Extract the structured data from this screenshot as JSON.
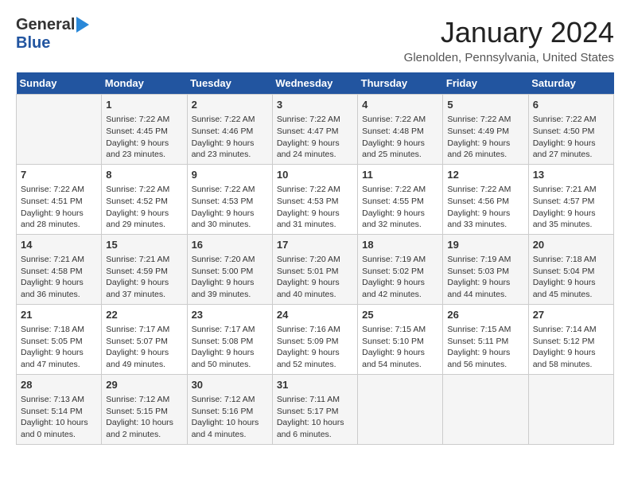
{
  "logo": {
    "general": "General",
    "blue": "Blue"
  },
  "title": "January 2024",
  "location": "Glenolden, Pennsylvania, United States",
  "days_header": [
    "Sunday",
    "Monday",
    "Tuesday",
    "Wednesday",
    "Thursday",
    "Friday",
    "Saturday"
  ],
  "weeks": [
    [
      {
        "day": "",
        "info": ""
      },
      {
        "day": "1",
        "info": "Sunrise: 7:22 AM\nSunset: 4:45 PM\nDaylight: 9 hours\nand 23 minutes."
      },
      {
        "day": "2",
        "info": "Sunrise: 7:22 AM\nSunset: 4:46 PM\nDaylight: 9 hours\nand 23 minutes."
      },
      {
        "day": "3",
        "info": "Sunrise: 7:22 AM\nSunset: 4:47 PM\nDaylight: 9 hours\nand 24 minutes."
      },
      {
        "day": "4",
        "info": "Sunrise: 7:22 AM\nSunset: 4:48 PM\nDaylight: 9 hours\nand 25 minutes."
      },
      {
        "day": "5",
        "info": "Sunrise: 7:22 AM\nSunset: 4:49 PM\nDaylight: 9 hours\nand 26 minutes."
      },
      {
        "day": "6",
        "info": "Sunrise: 7:22 AM\nSunset: 4:50 PM\nDaylight: 9 hours\nand 27 minutes."
      }
    ],
    [
      {
        "day": "7",
        "info": "Sunrise: 7:22 AM\nSunset: 4:51 PM\nDaylight: 9 hours\nand 28 minutes."
      },
      {
        "day": "8",
        "info": "Sunrise: 7:22 AM\nSunset: 4:52 PM\nDaylight: 9 hours\nand 29 minutes."
      },
      {
        "day": "9",
        "info": "Sunrise: 7:22 AM\nSunset: 4:53 PM\nDaylight: 9 hours\nand 30 minutes."
      },
      {
        "day": "10",
        "info": "Sunrise: 7:22 AM\nSunset: 4:53 PM\nDaylight: 9 hours\nand 31 minutes."
      },
      {
        "day": "11",
        "info": "Sunrise: 7:22 AM\nSunset: 4:55 PM\nDaylight: 9 hours\nand 32 minutes."
      },
      {
        "day": "12",
        "info": "Sunrise: 7:22 AM\nSunset: 4:56 PM\nDaylight: 9 hours\nand 33 minutes."
      },
      {
        "day": "13",
        "info": "Sunrise: 7:21 AM\nSunset: 4:57 PM\nDaylight: 9 hours\nand 35 minutes."
      }
    ],
    [
      {
        "day": "14",
        "info": "Sunrise: 7:21 AM\nSunset: 4:58 PM\nDaylight: 9 hours\nand 36 minutes."
      },
      {
        "day": "15",
        "info": "Sunrise: 7:21 AM\nSunset: 4:59 PM\nDaylight: 9 hours\nand 37 minutes."
      },
      {
        "day": "16",
        "info": "Sunrise: 7:20 AM\nSunset: 5:00 PM\nDaylight: 9 hours\nand 39 minutes."
      },
      {
        "day": "17",
        "info": "Sunrise: 7:20 AM\nSunset: 5:01 PM\nDaylight: 9 hours\nand 40 minutes."
      },
      {
        "day": "18",
        "info": "Sunrise: 7:19 AM\nSunset: 5:02 PM\nDaylight: 9 hours\nand 42 minutes."
      },
      {
        "day": "19",
        "info": "Sunrise: 7:19 AM\nSunset: 5:03 PM\nDaylight: 9 hours\nand 44 minutes."
      },
      {
        "day": "20",
        "info": "Sunrise: 7:18 AM\nSunset: 5:04 PM\nDaylight: 9 hours\nand 45 minutes."
      }
    ],
    [
      {
        "day": "21",
        "info": "Sunrise: 7:18 AM\nSunset: 5:05 PM\nDaylight: 9 hours\nand 47 minutes."
      },
      {
        "day": "22",
        "info": "Sunrise: 7:17 AM\nSunset: 5:07 PM\nDaylight: 9 hours\nand 49 minutes."
      },
      {
        "day": "23",
        "info": "Sunrise: 7:17 AM\nSunset: 5:08 PM\nDaylight: 9 hours\nand 50 minutes."
      },
      {
        "day": "24",
        "info": "Sunrise: 7:16 AM\nSunset: 5:09 PM\nDaylight: 9 hours\nand 52 minutes."
      },
      {
        "day": "25",
        "info": "Sunrise: 7:15 AM\nSunset: 5:10 PM\nDaylight: 9 hours\nand 54 minutes."
      },
      {
        "day": "26",
        "info": "Sunrise: 7:15 AM\nSunset: 5:11 PM\nDaylight: 9 hours\nand 56 minutes."
      },
      {
        "day": "27",
        "info": "Sunrise: 7:14 AM\nSunset: 5:12 PM\nDaylight: 9 hours\nand 58 minutes."
      }
    ],
    [
      {
        "day": "28",
        "info": "Sunrise: 7:13 AM\nSunset: 5:14 PM\nDaylight: 10 hours\nand 0 minutes."
      },
      {
        "day": "29",
        "info": "Sunrise: 7:12 AM\nSunset: 5:15 PM\nDaylight: 10 hours\nand 2 minutes."
      },
      {
        "day": "30",
        "info": "Sunrise: 7:12 AM\nSunset: 5:16 PM\nDaylight: 10 hours\nand 4 minutes."
      },
      {
        "day": "31",
        "info": "Sunrise: 7:11 AM\nSunset: 5:17 PM\nDaylight: 10 hours\nand 6 minutes."
      },
      {
        "day": "",
        "info": ""
      },
      {
        "day": "",
        "info": ""
      },
      {
        "day": "",
        "info": ""
      }
    ]
  ]
}
